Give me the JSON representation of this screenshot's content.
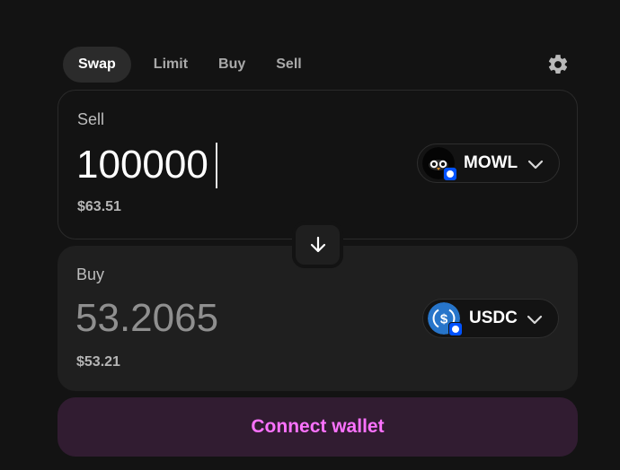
{
  "tabs": [
    {
      "label": "Swap",
      "active": true
    },
    {
      "label": "Limit",
      "active": false
    },
    {
      "label": "Buy",
      "active": false
    },
    {
      "label": "Sell",
      "active": false
    }
  ],
  "settings_icon": "gear-icon",
  "sell": {
    "label": "Sell",
    "amount": "100000",
    "fiat_value": "$63.51",
    "token": {
      "symbol": "MOWL",
      "icon": "owl-logo-icon",
      "chain_badge": "base-chain-icon"
    }
  },
  "switch_icon": "arrow-down-icon",
  "buy": {
    "label": "Buy",
    "amount": "53.2065",
    "fiat_value": "$53.21",
    "token": {
      "symbol": "USDC",
      "icon": "usdc-logo-icon",
      "chain_badge": "base-chain-icon"
    }
  },
  "connect_wallet": {
    "label": "Connect wallet"
  },
  "colors": {
    "background": "#131313",
    "panel": "#1f1f1f",
    "accent": "#fc72ff",
    "connect_bg": "#311c31",
    "usdc_blue": "#2775ca",
    "base_blue": "#0052ff"
  }
}
